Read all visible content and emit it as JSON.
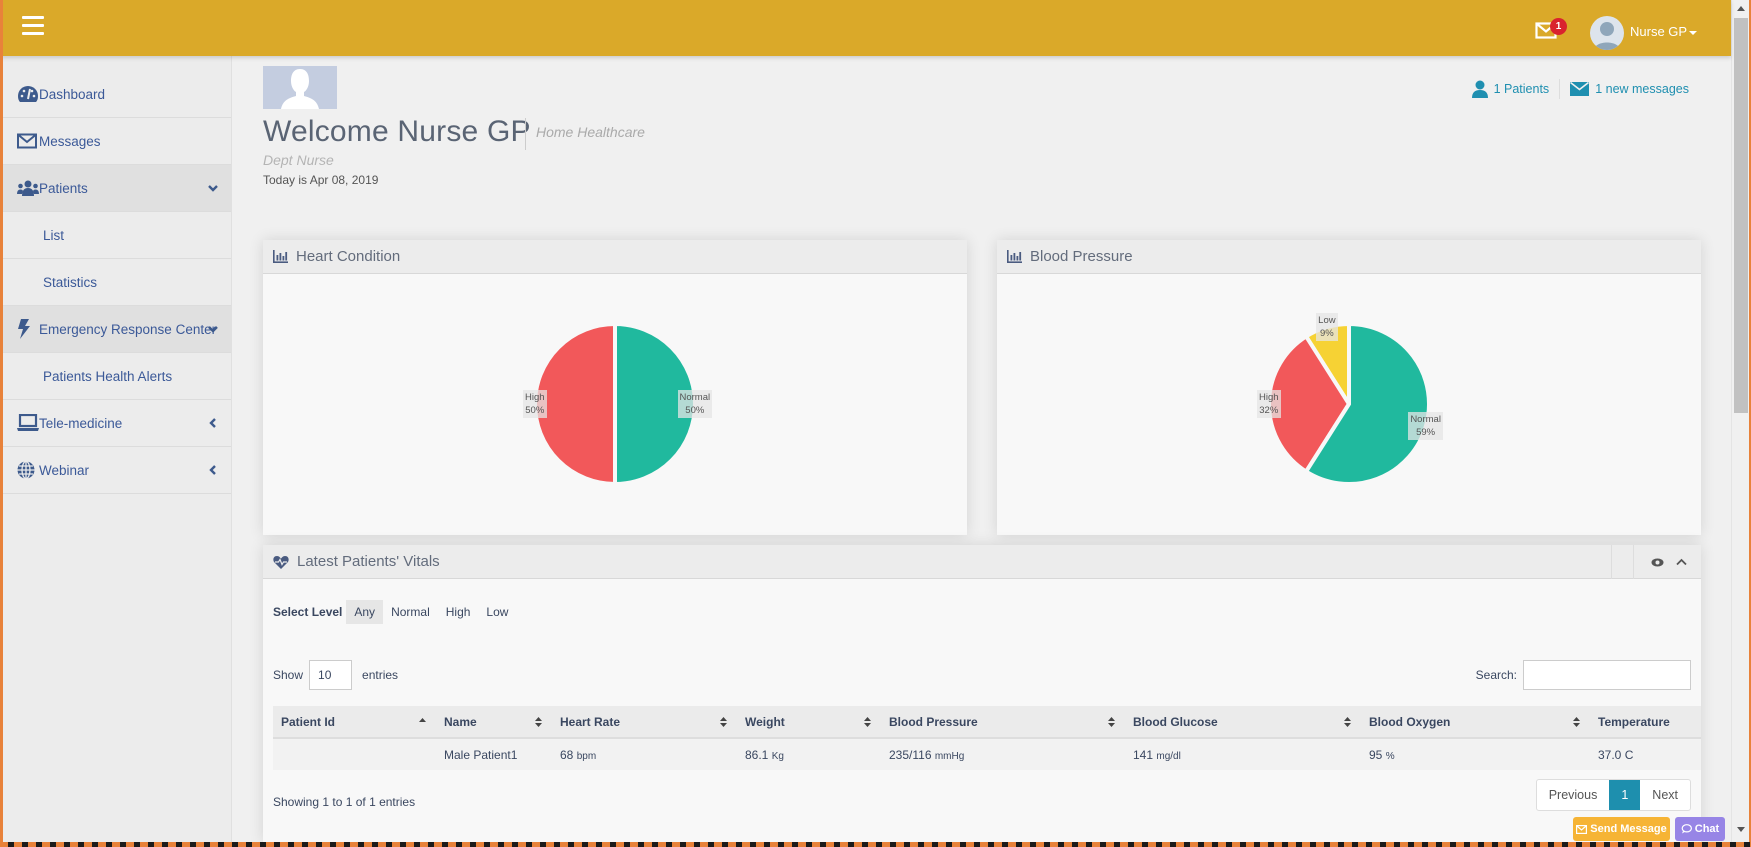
{
  "header": {
    "messages_badge": "1",
    "user_name": "Nurse GP",
    "brand_color": "#daa929"
  },
  "sidebar": {
    "items": [
      {
        "label": "Dashboard",
        "icon": "dashboard-icon"
      },
      {
        "label": "Messages",
        "icon": "envelope-icon"
      },
      {
        "label": "Patients",
        "icon": "users-icon",
        "expanded": true
      },
      {
        "label": "List",
        "sub": true
      },
      {
        "label": "Statistics",
        "sub": true
      },
      {
        "label": "Emergency Response Center",
        "icon": "bolt-icon",
        "expanded": true
      },
      {
        "label": "Patients Health Alerts",
        "sub": true
      },
      {
        "label": "Tele-medicine",
        "icon": "laptop-icon",
        "expanded": false
      },
      {
        "label": "Webinar",
        "icon": "globe-icon",
        "expanded": false
      }
    ]
  },
  "profile": {
    "welcome": "Welcome Nurse GP",
    "organization": "Home Healthcare",
    "department": "Dept Nurse",
    "today": "Today is Apr 08, 2019"
  },
  "top_stats": {
    "patients": "1 Patients",
    "messages": "1 new messages"
  },
  "chart_data": [
    {
      "type": "pie",
      "title": "Heart Condition",
      "categories": [
        "High",
        "Normal"
      ],
      "values": [
        50,
        50
      ],
      "labels": [
        "50%",
        "50%"
      ],
      "colors": [
        "#f2585a",
        "#20b99e"
      ]
    },
    {
      "type": "pie",
      "title": "Blood Pressure",
      "categories": [
        "Low",
        "High",
        "Normal"
      ],
      "values": [
        9,
        32,
        59
      ],
      "labels": [
        "9%",
        "32%",
        "59%"
      ],
      "colors": [
        "#f6d234",
        "#f2585a",
        "#20b99e"
      ]
    }
  ],
  "vitals": {
    "title": "Latest Patients' Vitals",
    "select_level_label": "Select Level",
    "levels": [
      "Any",
      "Normal",
      "High",
      "Low"
    ],
    "selected_level": "Any",
    "show_label": "Show",
    "entries_value": "10",
    "entries_label": "entries",
    "search_label": "Search:",
    "search_value": "",
    "columns": [
      "Patient Id",
      "Name",
      "Heart Rate",
      "Weight",
      "Blood Pressure",
      "Blood Glucose",
      "Blood Oxygen",
      "Temperature"
    ],
    "rows": [
      {
        "patient_id": "",
        "name": "Male Patient1",
        "heart_rate": "68",
        "heart_rate_unit": "bpm",
        "weight": "86.1",
        "weight_unit": "Kg",
        "blood_pressure": "235/116",
        "blood_pressure_unit": "mmHg",
        "blood_glucose": "141",
        "blood_glucose_unit": "mg/dl",
        "blood_oxygen": "95",
        "blood_oxygen_unit": "%",
        "temperature": "37.0 C"
      }
    ],
    "showing": "Showing 1 to 1 of 1 entries",
    "pager": {
      "previous": "Previous",
      "current": "1",
      "next": "Next"
    }
  },
  "floating": {
    "send_message": "Send Message",
    "chat": "Chat"
  }
}
